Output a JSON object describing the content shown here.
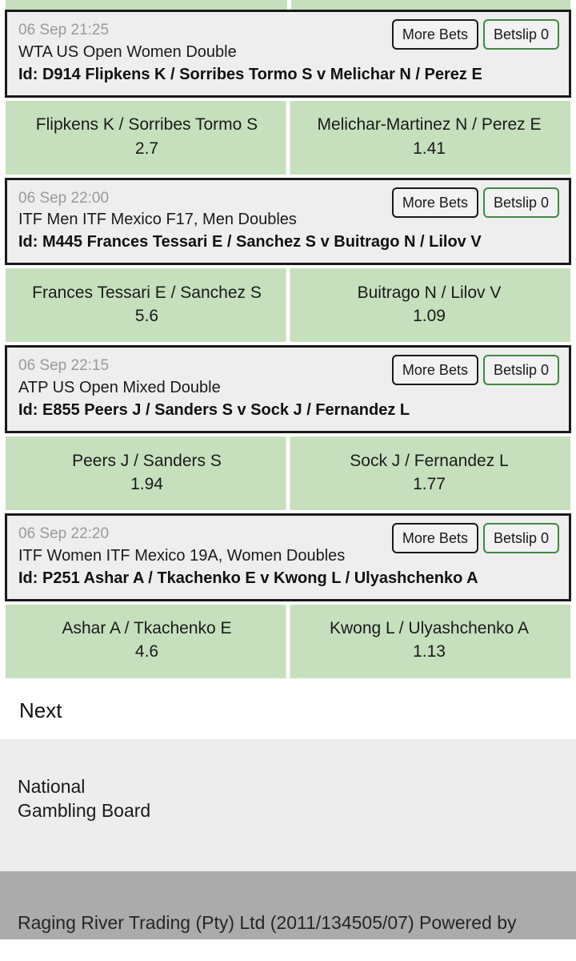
{
  "top_partial_row": {
    "visible": true,
    "note": "clipped green selection row from previous event"
  },
  "buttons": {
    "more_bets_label": "More Bets",
    "betslip_label": "Betslip 0",
    "betslip_count": 0
  },
  "colors": {
    "selection_green": "#c6e0bd",
    "header_grey": "#eeeeee",
    "betslip_border_green": "#3e8b41",
    "more_bets_border": "#1a1a1a",
    "footer_grey": "#ababab",
    "responsible_grey": "#ededed",
    "muted_text": "#9a9a9a"
  },
  "events": [
    {
      "time": "06 Sep 21:25",
      "league": "WTA US Open Women Double",
      "id_line": "Id: D914 Flipkens K / Sorribes Tormo S v Melichar N / Perez E",
      "selections": [
        {
          "name": "Flipkens K / Sorribes Tormo S",
          "price": "2.7"
        },
        {
          "name": "Melichar-Martinez N / Perez E",
          "price": "1.41"
        }
      ]
    },
    {
      "time": "06 Sep 22:00",
      "league": "ITF Men ITF Mexico F17, Men Doubles",
      "id_line": "Id: M445 Frances Tessari E / Sanchez S v Buitrago N / Lilov V",
      "selections": [
        {
          "name": "Frances Tessari E / Sanchez S",
          "price": "5.6"
        },
        {
          "name": "Buitrago N / Lilov V",
          "price": "1.09"
        }
      ]
    },
    {
      "time": "06 Sep 22:15",
      "league": "ATP US Open Mixed Double",
      "id_line": "Id: E855 Peers J / Sanders S v Sock J / Fernandez L",
      "selections": [
        {
          "name": "Peers J / Sanders S",
          "price": "1.94"
        },
        {
          "name": "Sock J / Fernandez L",
          "price": "1.77"
        }
      ]
    },
    {
      "time": "06 Sep 22:20",
      "league": "ITF Women ITF Mexico 19A, Women Doubles",
      "id_line": "Id: P251 Ashar A / Tkachenko E v Kwong L / Ulyashchenko A",
      "selections": [
        {
          "name": "Ashar A / Tkachenko E",
          "price": "4.6"
        },
        {
          "name": "Kwong L / Ulyashchenko A",
          "price": "1.13"
        }
      ]
    }
  ],
  "pagination": {
    "next_label": "Next"
  },
  "responsible_gambling": {
    "line1": "National",
    "line2": "Gambling Board"
  },
  "footer": {
    "text": "Raging River Trading (Pty) Ltd (2011/134505/07) Powered by"
  }
}
